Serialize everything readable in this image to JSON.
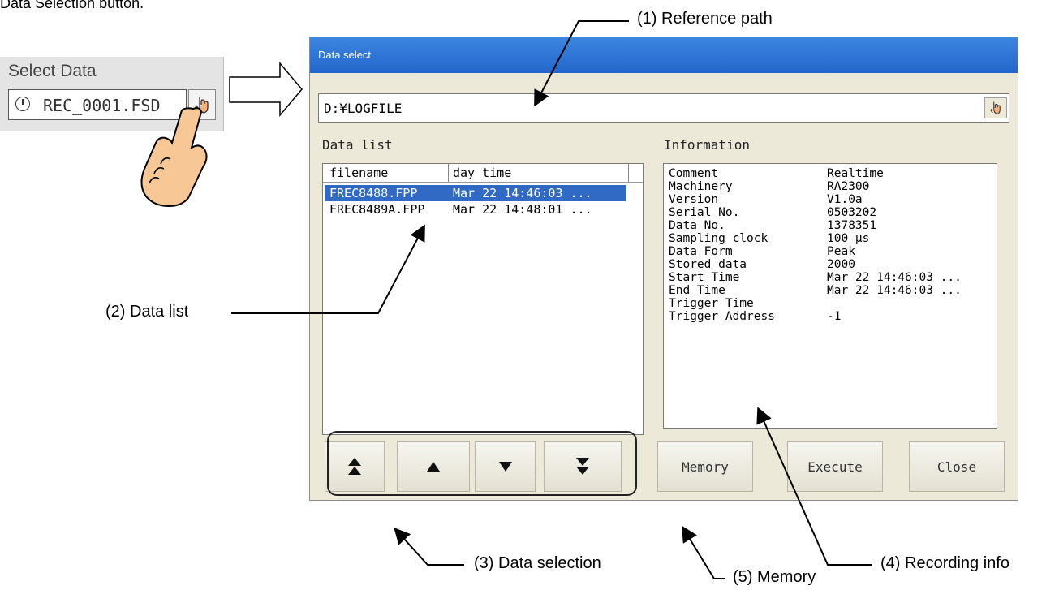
{
  "intro_caption": "Data Selection button.",
  "select_widget": {
    "label": "Select Data",
    "value": "REC_0001.FSD",
    "clock_icon": "clock-icon",
    "pointer_icon": "hand-pointer-icon"
  },
  "dialog": {
    "title": "Data select",
    "path": "D:¥LOGFILE",
    "data_list_label": "Data list",
    "information_label": "Information",
    "columns": [
      "filename",
      "day time"
    ],
    "rows": [
      {
        "filename": "FREC8488.FPP",
        "daytime": "Mar 22 14:46:03 ...",
        "selected": true
      },
      {
        "filename": "FREC8489A.FPP",
        "daytime": "Mar 22 14:48:01 ...",
        "selected": false
      }
    ],
    "info": [
      {
        "key": "Comment",
        "value": "Realtime"
      },
      {
        "key": "Machinery",
        "value": "RA2300"
      },
      {
        "key": "Version",
        "value": "V1.0a"
      },
      {
        "key": "Serial No.",
        "value": "0503202"
      },
      {
        "key": "Data No.",
        "value": "1378351"
      },
      {
        "key": "Sampling clock",
        "value": "100 μs"
      },
      {
        "key": "Data Form",
        "value": "Peak"
      },
      {
        "key": "Stored data",
        "value": "2000"
      },
      {
        "key": "Start Time",
        "value": "Mar 22 14:46:03 ..."
      },
      {
        "key": "End Time",
        "value": "Mar 22 14:46:03 ..."
      },
      {
        "key": "Trigger Time",
        "value": ""
      },
      {
        "key": "Trigger Address",
        "value": "-1"
      }
    ],
    "buttons": {
      "top": "top-arrow-icon",
      "up": "up-arrow-icon",
      "down": "down-arrow-icon",
      "bottom": "bottom-arrow-icon",
      "memory": "Memory",
      "execute": "Execute",
      "close": "Close"
    }
  },
  "annotations": {
    "reference_path": "(1) Reference path",
    "data_list": "(2) Data list",
    "data_selection": "(3) Data selection",
    "recording_info": "(4) Recording info",
    "memory": "(5) Memory"
  },
  "colors": {
    "titlebar": "#2f74d6",
    "dialog_bg": "#ece9d8",
    "selection": "#316ac5",
    "hand_skin": "#f7c896"
  }
}
